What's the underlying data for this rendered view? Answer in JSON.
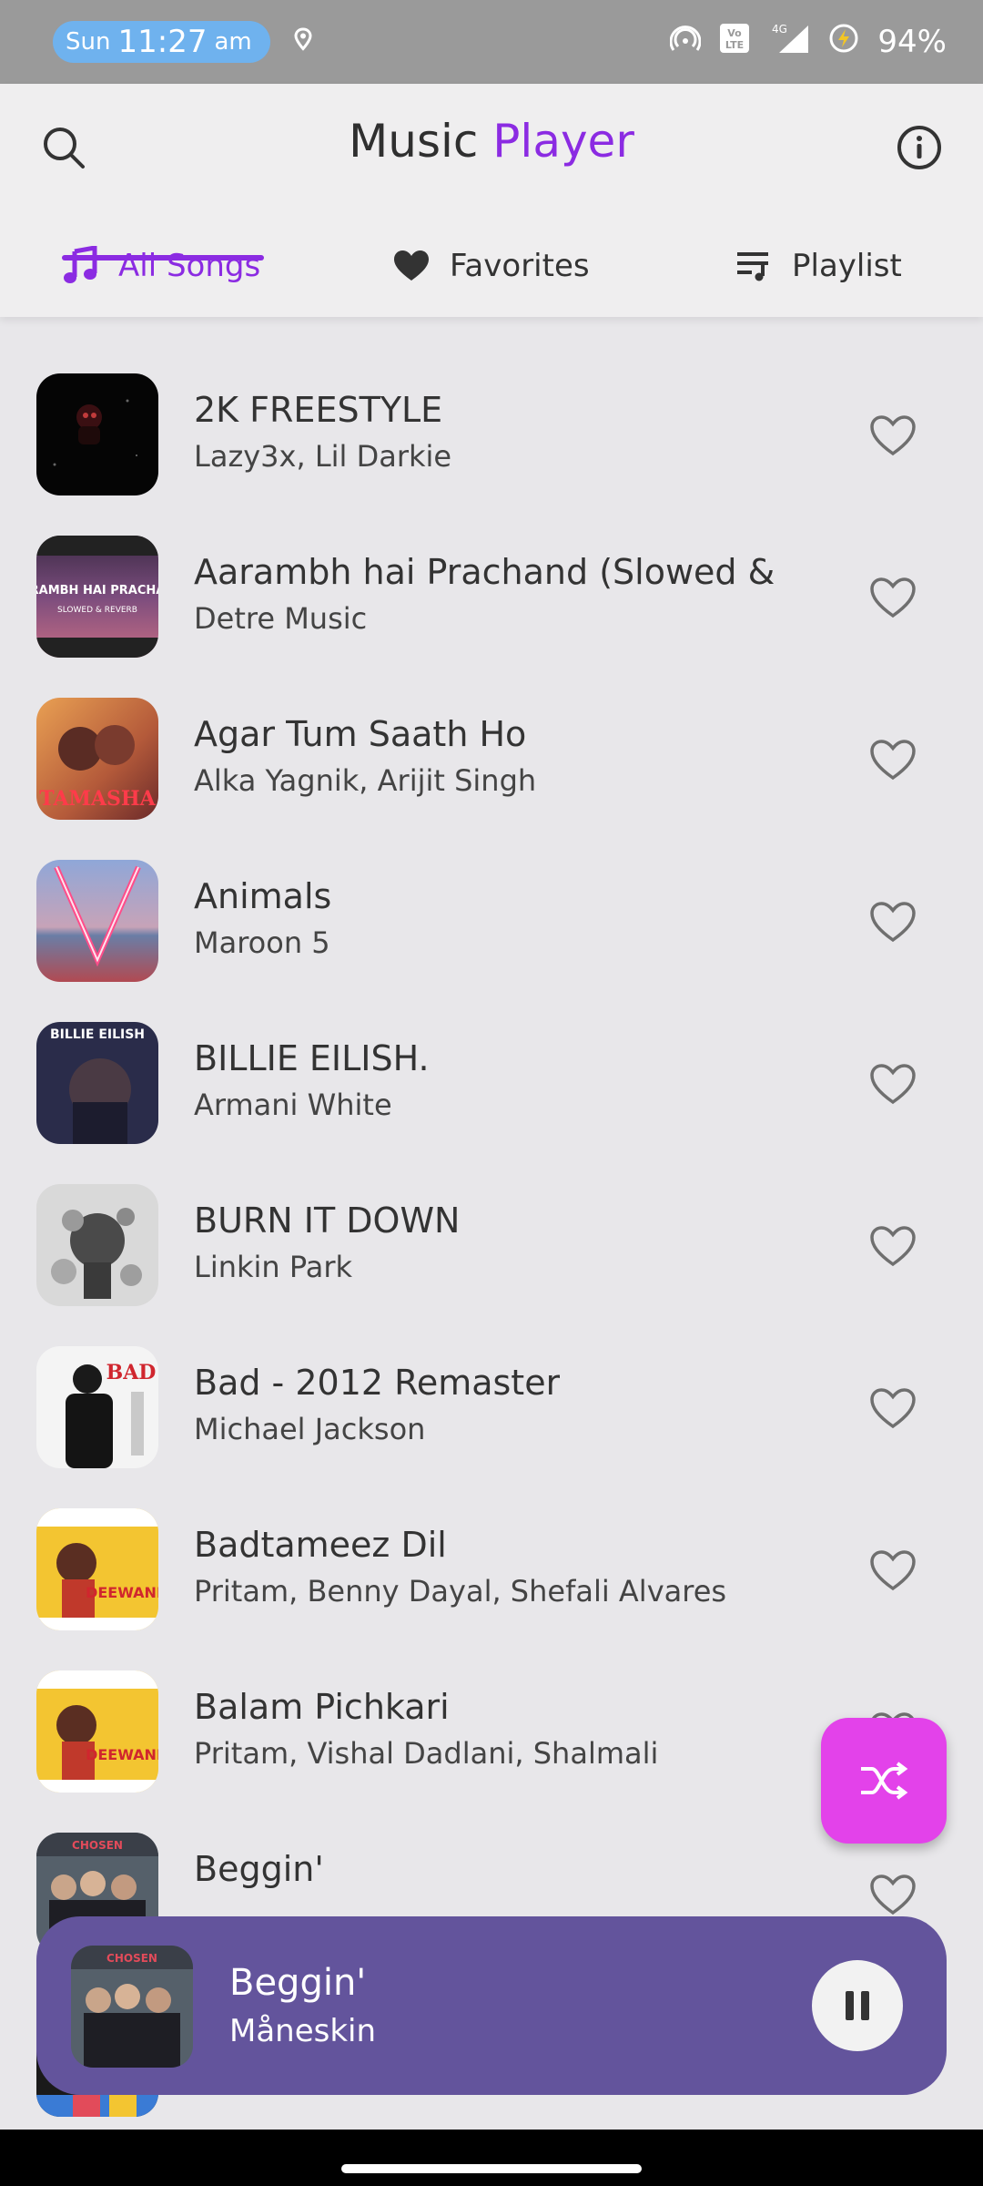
{
  "status_bar": {
    "day": "Sun",
    "time": "11:27",
    "ampm": "am",
    "battery": "94%",
    "network_label": "4G",
    "volte_label": "Vo LTE"
  },
  "header": {
    "title_part1": "Music",
    "title_part2": "Player",
    "accent_color": "#8b2be2"
  },
  "tabs": [
    {
      "label": "All Songs",
      "icon": "music-note-icon",
      "active": true
    },
    {
      "label": "Favorites",
      "icon": "heart-icon",
      "active": false
    },
    {
      "label": "Playlist",
      "icon": "playlist-icon",
      "active": false
    }
  ],
  "songs": [
    {
      "title": "2K FREESTYLE",
      "artist": "Lazy3x, Lil Darkie"
    },
    {
      "title": "Aarambh hai Prachand (Slowed &",
      "artist": "Detre Music",
      "cover_text": "RAMBH HAI PRACHA",
      "cover_subtext": "SLOWED & REVERB"
    },
    {
      "title": "Agar Tum Saath Ho",
      "artist": "Alka Yagnik, Arijit Singh",
      "cover_text": "TAMASHA"
    },
    {
      "title": "Animals",
      "artist": "Maroon 5"
    },
    {
      "title": "BILLIE EILISH.",
      "artist": "Armani White",
      "cover_text": "BILLIE EILISH"
    },
    {
      "title": "BURN IT DOWN",
      "artist": "Linkin Park"
    },
    {
      "title": "Bad - 2012 Remaster",
      "artist": "Michael Jackson",
      "cover_text": "BAD"
    },
    {
      "title": "Badtameez Dil",
      "artist": "Pritam, Benny Dayal, Shefali Alvares",
      "cover_text": "DEEWANI"
    },
    {
      "title": "Balam Pichkari",
      "artist": "Pritam, Vishal Dadlani, Shalmali",
      "cover_text": "DEEWANI"
    },
    {
      "title": "Beggin'",
      "artist": "Måneskin",
      "cover_text": "CHOSEN"
    }
  ],
  "now_playing": {
    "title": "Beggin'",
    "artist": "Måneskin",
    "cover_text": "CHOSEN",
    "background": "#63549c"
  },
  "shuffle": {
    "color": "#e342ea"
  }
}
